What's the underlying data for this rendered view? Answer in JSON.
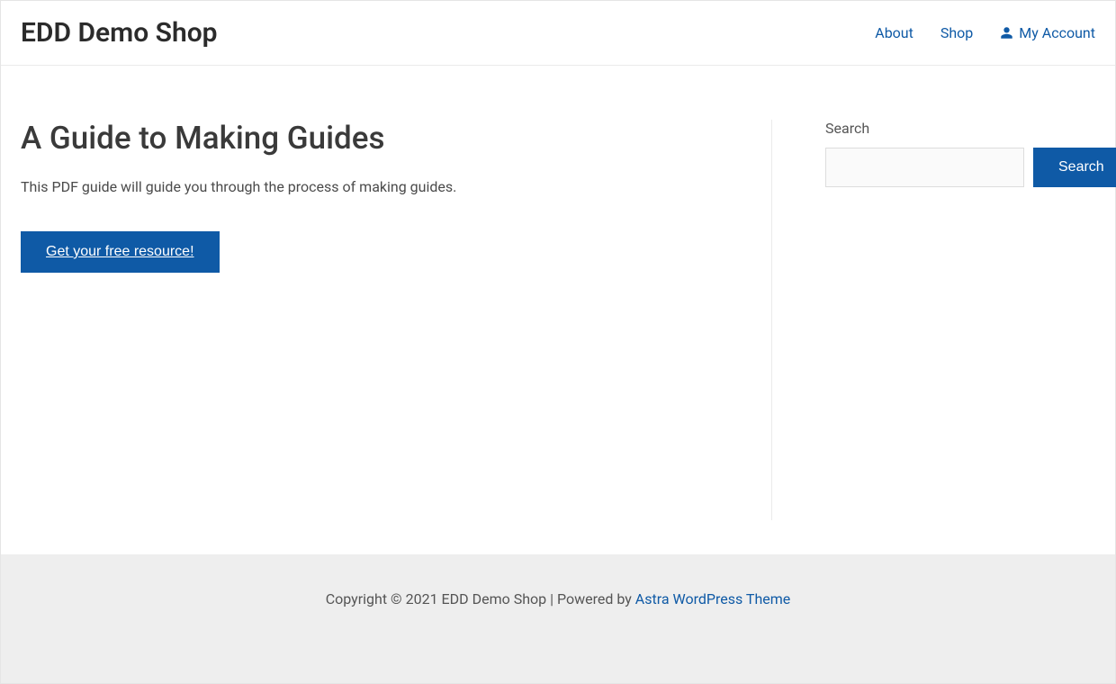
{
  "header": {
    "site_title": "EDD Demo Shop",
    "nav": {
      "about": "About",
      "shop": "Shop",
      "my_account": "My Account"
    }
  },
  "main": {
    "title": "A Guide to Making Guides",
    "description": "This PDF guide will guide you through the process of making guides.",
    "cta_label": "Get your free resource!"
  },
  "sidebar": {
    "search_label": "Search",
    "search_button": "Search"
  },
  "footer": {
    "copyright": "Copyright © 2021 EDD Demo Shop | Powered by ",
    "theme_link": "Astra WordPress Theme"
  }
}
